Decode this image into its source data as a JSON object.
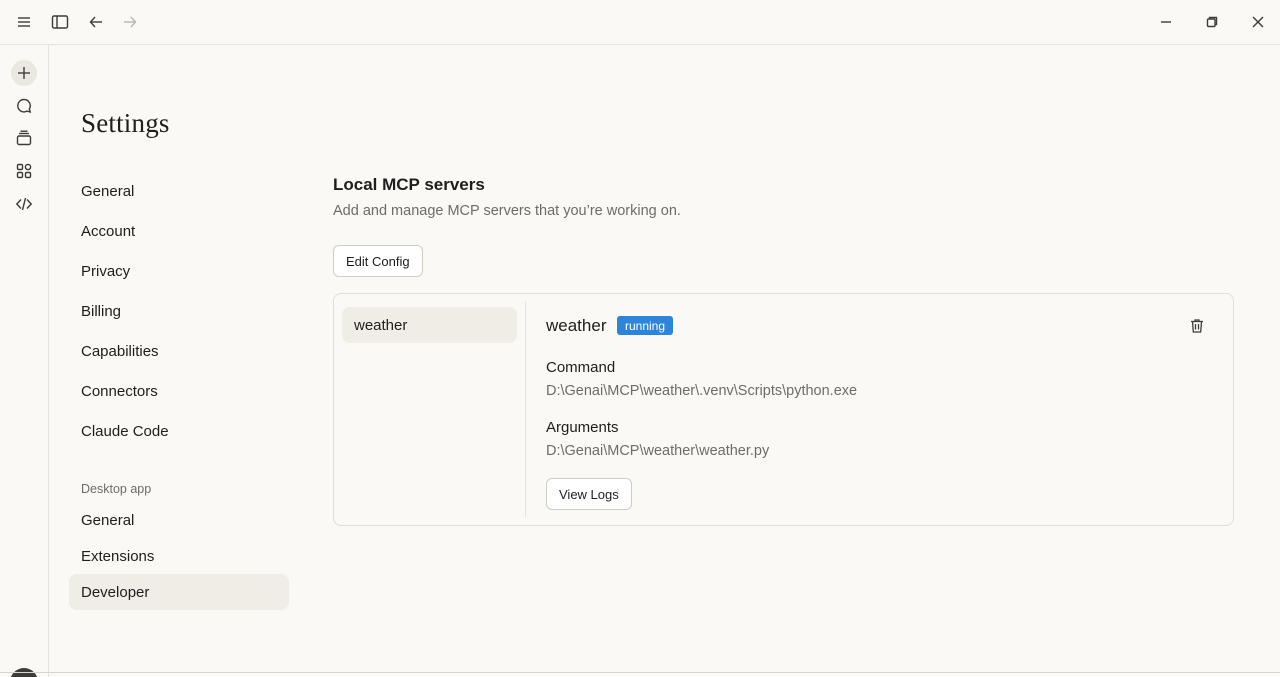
{
  "titlebar": {
    "icons": [
      "menu-icon",
      "sidebar-toggle-icon",
      "back-arrow-icon",
      "forward-arrow-icon",
      "minimize-icon",
      "restore-icon",
      "close-icon"
    ]
  },
  "rail": {
    "icons": [
      "plus-icon",
      "chat-icon",
      "projects-icon",
      "artifacts-icon",
      "code-icon"
    ]
  },
  "settings": {
    "title": "Settings",
    "nav": [
      "General",
      "Account",
      "Privacy",
      "Billing",
      "Capabilities",
      "Connectors",
      "Claude Code"
    ],
    "desktop_section": "Desktop app",
    "desktop_nav": [
      "General",
      "Extensions",
      "Developer"
    ],
    "active": "Developer"
  },
  "mcp": {
    "title": "Local MCP servers",
    "subtitle": "Add and manage MCP servers that you’re working on.",
    "edit_config_label": "Edit Config",
    "servers": [
      "weather"
    ],
    "selected": {
      "name": "weather",
      "status": "running",
      "status_color": "#2c84db",
      "command_label": "Command",
      "command_value": "D:\\Genai\\MCP\\weather\\.venv\\Scripts\\python.exe",
      "arguments_label": "Arguments",
      "arguments_value": "D:\\Genai\\MCP\\weather\\weather.py",
      "view_logs_label": "View Logs"
    }
  }
}
